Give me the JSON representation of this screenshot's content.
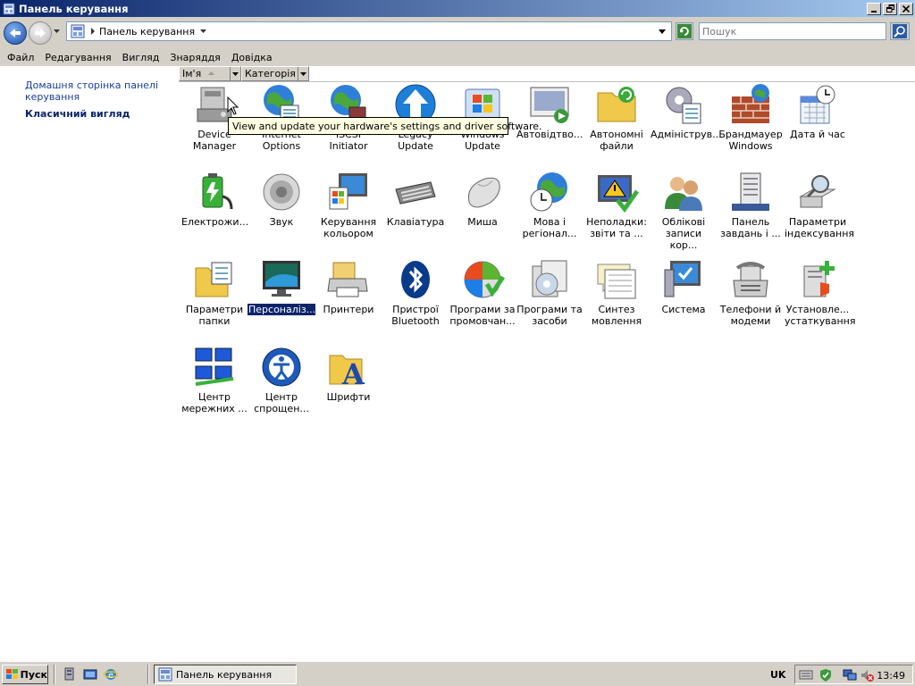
{
  "window": {
    "title": "Панель керування",
    "buttons": [
      "minimize",
      "restore",
      "close"
    ]
  },
  "address": {
    "path": "Панель керування",
    "search_placeholder": "Пошук"
  },
  "menu": [
    "Файл",
    "Редагування",
    "Вигляд",
    "Знаряддя",
    "Довідка"
  ],
  "columns": [
    "Ім'я",
    "Категорія"
  ],
  "sidebar": {
    "home_link": "Домашня сторінка панелі керування",
    "classic_view": "Класичний вигляд"
  },
  "tooltip": "View and update your hardware's settings and driver software.",
  "items": [
    {
      "label": "Device Manager",
      "icon": "device-manager-icon"
    },
    {
      "label": "Internet Options",
      "icon": "internet-options-icon"
    },
    {
      "label": "iSCSI Initiator",
      "icon": "iscsi-initiator-icon"
    },
    {
      "label": "Legacy Update",
      "icon": "legacy-update-icon"
    },
    {
      "label": "Windows Update",
      "icon": "windows-update-icon"
    },
    {
      "label": "Автовідтво...",
      "icon": "autoplay-icon"
    },
    {
      "label": "Автономні файли",
      "icon": "offline-files-icon"
    },
    {
      "label": "Адмініструв...",
      "icon": "admin-tools-icon"
    },
    {
      "label": "Брандмауер Windows",
      "icon": "firewall-icon"
    },
    {
      "label": "Дата й час",
      "icon": "date-time-icon"
    },
    {
      "label": "Електрожи...",
      "icon": "power-options-icon"
    },
    {
      "label": "Звук",
      "icon": "sound-icon"
    },
    {
      "label": "Керування кольором",
      "icon": "color-management-icon"
    },
    {
      "label": "Клавіатура",
      "icon": "keyboard-icon"
    },
    {
      "label": "Миша",
      "icon": "mouse-icon"
    },
    {
      "label": "Мова і регіонал...",
      "icon": "regional-icon"
    },
    {
      "label": "Неполадки: звіти та ...",
      "icon": "problem-reports-icon"
    },
    {
      "label": "Облікові записи кор...",
      "icon": "user-accounts-icon"
    },
    {
      "label": "Панель завдань і ...",
      "icon": "taskbar-icon"
    },
    {
      "label": "Параметри індексування",
      "icon": "indexing-icon"
    },
    {
      "label": "Параметри папки",
      "icon": "folder-options-icon"
    },
    {
      "label": "Персоналіз...",
      "icon": "personalization-icon",
      "selected": true
    },
    {
      "label": "Принтери",
      "icon": "printers-icon"
    },
    {
      "label": "Пристрої Bluetooth",
      "icon": "bluetooth-icon"
    },
    {
      "label": "Програми за промовчан...",
      "icon": "default-programs-icon"
    },
    {
      "label": "Програми та засоби",
      "icon": "programs-features-icon"
    },
    {
      "label": "Синтез мовлення",
      "icon": "speech-icon"
    },
    {
      "label": "Система",
      "icon": "system-icon"
    },
    {
      "label": "Телефони й модеми",
      "icon": "phone-modem-icon"
    },
    {
      "label": "Установле... устаткування",
      "icon": "add-hardware-icon"
    },
    {
      "label": "Центр мережних ...",
      "icon": "network-center-icon"
    },
    {
      "label": "Центр спрощен...",
      "icon": "ease-of-access-icon"
    },
    {
      "label": "Шрифти",
      "icon": "fonts-icon"
    }
  ],
  "taskbar": {
    "start": "Пуск",
    "window_button": "Панель керування",
    "language": "UK",
    "clock": "13:49"
  }
}
